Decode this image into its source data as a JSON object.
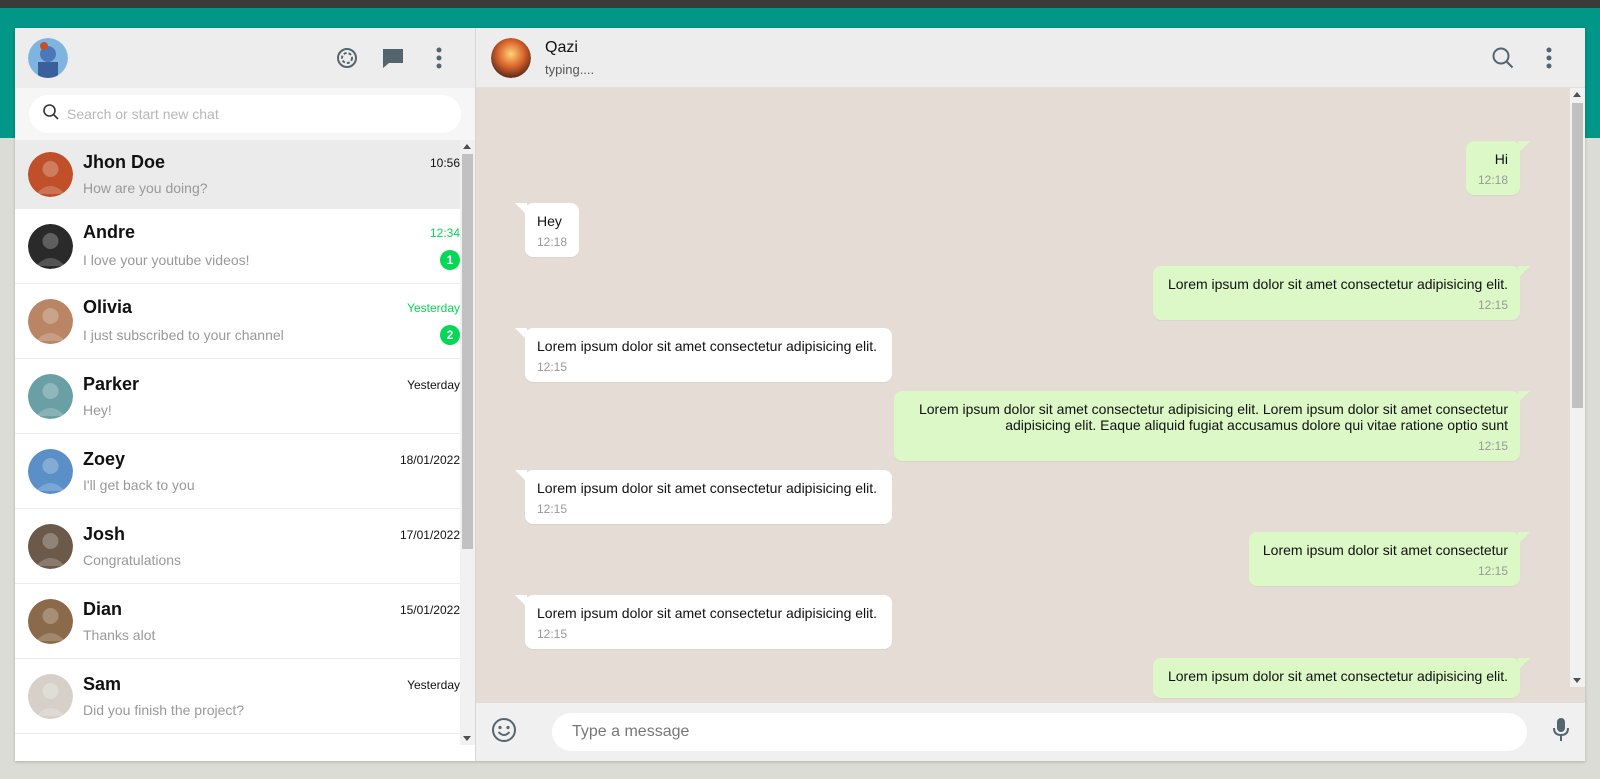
{
  "left_header": {
    "profile_avatar": "profile-avatar",
    "icons": [
      "status-icon",
      "new-chat-icon",
      "menu-dots-icon"
    ]
  },
  "search": {
    "placeholder": "Search or start new chat"
  },
  "chats": [
    {
      "name": "Jhon Doe",
      "last": "How are you doing?",
      "time": "10:56",
      "unread": "",
      "active": true,
      "avatar_color": "#c0502a"
    },
    {
      "name": "Andre",
      "last": "I love your youtube videos!",
      "time": "12:34",
      "unread": "1",
      "active": false,
      "avatar_color": "#2a2a2a"
    },
    {
      "name": "Olivia",
      "last": "I just subscribed to your channel",
      "time": "Yesterday",
      "unread": "2",
      "active": false,
      "avatar_color": "#b98564"
    },
    {
      "name": "Parker",
      "last": "Hey!",
      "time": "Yesterday",
      "unread": "",
      "active": false,
      "avatar_color": "#6aa0a5"
    },
    {
      "name": "Zoey",
      "last": "I'll get back to you",
      "time": "18/01/2022",
      "unread": "",
      "active": false,
      "avatar_color": "#5a8fc8"
    },
    {
      "name": "Josh",
      "last": "Congratulations",
      "time": "17/01/2022",
      "unread": "",
      "active": false,
      "avatar_color": "#6b5a4a"
    },
    {
      "name": "Dian",
      "last": "Thanks alot",
      "time": "15/01/2022",
      "unread": "",
      "active": false,
      "avatar_color": "#8a6a4a"
    },
    {
      "name": "Sam",
      "last": "Did you finish the project?",
      "time": "Yesterday",
      "unread": "",
      "active": false,
      "avatar_color": "#d6d0c8"
    }
  ],
  "conversation": {
    "contact_name": "Qazi",
    "status": "typing....",
    "icons": [
      "search-icon",
      "menu-dots-icon"
    ]
  },
  "messages": [
    {
      "from": "me",
      "text": "Hi",
      "time": "12:18"
    },
    {
      "from": "them",
      "text": "Hey",
      "time": "12:18"
    },
    {
      "from": "me",
      "text": "Lorem ipsum dolor sit amet consectetur adipisicing elit.",
      "time": "12:15"
    },
    {
      "from": "them",
      "text": "Lorem ipsum dolor sit amet consectetur adipisicing elit.",
      "time": "12:15"
    },
    {
      "from": "me",
      "text": "Lorem ipsum dolor sit amet consectetur adipisicing elit. Lorem ipsum dolor sit amet consectetur adipisicing elit. Eaque aliquid fugiat accusamus dolore qui vitae ratione optio sunt",
      "time": "12:15"
    },
    {
      "from": "them",
      "text": "Lorem ipsum dolor sit amet consectetur adipisicing elit.",
      "time": "12:15"
    },
    {
      "from": "me",
      "text": "Lorem ipsum dolor sit amet consectetur",
      "time": "12:15"
    },
    {
      "from": "them",
      "text": "Lorem ipsum dolor sit amet consectetur adipisicing elit.",
      "time": "12:15"
    },
    {
      "from": "me",
      "text": "Lorem ipsum dolor sit amet consectetur adipisicing elit.",
      "time": ""
    }
  ],
  "composer": {
    "placeholder": "Type a message",
    "left_icon": "emoji-icon",
    "right_icon": "microphone-icon"
  },
  "colors": {
    "teal": "#009688",
    "unread_green": "#06d755",
    "outgoing_bubble": "#dcf8c6",
    "chat_background": "#e5ddd5"
  }
}
